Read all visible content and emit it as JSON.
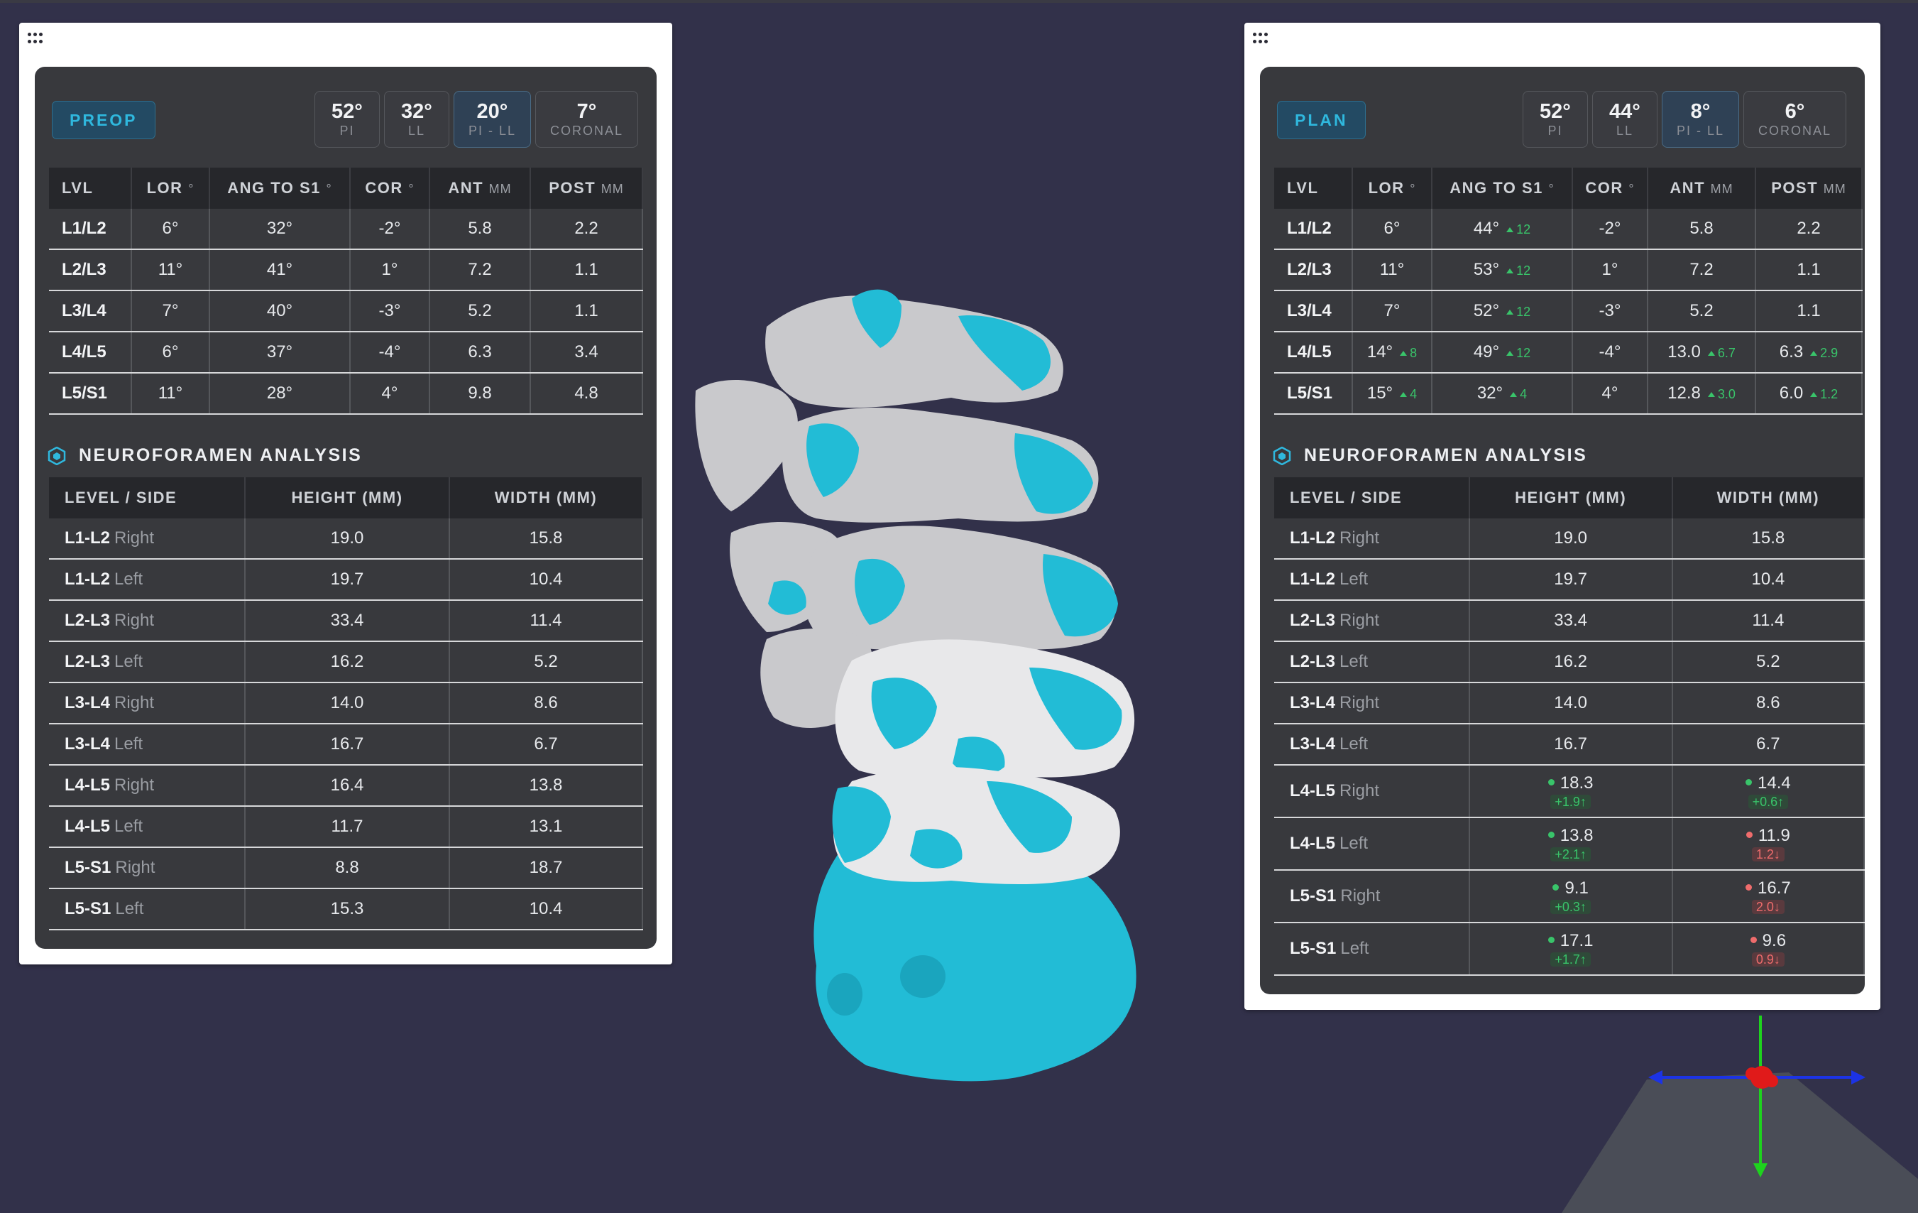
{
  "colors": {
    "background": "#32314a",
    "accent": "#2fb8de",
    "positive": "#39c46a",
    "negative": "#ef6c6c",
    "bone_gray": "#c9c9cc",
    "bone_cyan": "#22bcd6"
  },
  "icons": {
    "drag": "drag-handle-icon",
    "section": "hexagon-icon"
  },
  "panels": [
    {
      "mode": "PREOP",
      "stats": [
        {
          "value": "52°",
          "label": "PI"
        },
        {
          "value": "32°",
          "label": "LL"
        },
        {
          "value": "20°",
          "label": "PI - LL"
        },
        {
          "value": "7°",
          "label": "CORONAL"
        }
      ],
      "headers": {
        "lvl": "LVL",
        "lor": "LOR",
        "lor_unit": "°",
        "ang": "ANG TO S1",
        "ang_unit": "°",
        "cor": "COR",
        "cor_unit": "°",
        "ant": "ANT",
        "ant_unit": "MM",
        "post": "POST",
        "post_unit": "MM"
      },
      "levels": [
        {
          "lvl": "L1/L2",
          "lor": "6°",
          "ang": "32°",
          "cor": "-2°",
          "ant": "5.8",
          "post": "2.2"
        },
        {
          "lvl": "L2/L3",
          "lor": "11°",
          "ang": "41°",
          "cor": "1°",
          "ant": "7.2",
          "post": "1.1"
        },
        {
          "lvl": "L3/L4",
          "lor": "7°",
          "ang": "40°",
          "cor": "-3°",
          "ant": "5.2",
          "post": "1.1"
        },
        {
          "lvl": "L4/L5",
          "lor": "6°",
          "ang": "37°",
          "cor": "-4°",
          "ant": "6.3",
          "post": "3.4"
        },
        {
          "lvl": "L5/S1",
          "lor": "11°",
          "ang": "28°",
          "cor": "4°",
          "ant": "9.8",
          "post": "4.8"
        }
      ],
      "nf_title": "NEUROFORAMEN ANALYSIS",
      "nf_headers": {
        "level": "LEVEL / SIDE",
        "height": "HEIGHT (MM)",
        "width": "WIDTH (MM)"
      },
      "nf_rows": [
        {
          "level": "L1-L2",
          "side": "Right",
          "height": "19.0",
          "width": "15.8"
        },
        {
          "level": "L1-L2",
          "side": "Left",
          "height": "19.7",
          "width": "10.4"
        },
        {
          "level": "L2-L3",
          "side": "Right",
          "height": "33.4",
          "width": "11.4"
        },
        {
          "level": "L2-L3",
          "side": "Left",
          "height": "16.2",
          "width": "5.2"
        },
        {
          "level": "L3-L4",
          "side": "Right",
          "height": "14.0",
          "width": "8.6"
        },
        {
          "level": "L3-L4",
          "side": "Left",
          "height": "16.7",
          "width": "6.7"
        },
        {
          "level": "L4-L5",
          "side": "Right",
          "height": "16.4",
          "width": "13.8"
        },
        {
          "level": "L4-L5",
          "side": "Left",
          "height": "11.7",
          "width": "13.1"
        },
        {
          "level": "L5-S1",
          "side": "Right",
          "height": "8.8",
          "width": "18.7"
        },
        {
          "level": "L5-S1",
          "side": "Left",
          "height": "15.3",
          "width": "10.4"
        }
      ]
    },
    {
      "mode": "PLAN",
      "stats": [
        {
          "value": "52°",
          "label": "PI"
        },
        {
          "value": "44°",
          "label": "LL"
        },
        {
          "value": "8°",
          "label": "PI - LL"
        },
        {
          "value": "6°",
          "label": "CORONAL"
        }
      ],
      "headers": {
        "lvl": "LVL",
        "lor": "LOR",
        "lor_unit": "°",
        "ang": "ANG TO S1",
        "ang_unit": "°",
        "cor": "COR",
        "cor_unit": "°",
        "ant": "ANT",
        "ant_unit": "MM",
        "post": "POST",
        "post_unit": "MM"
      },
      "levels": [
        {
          "lvl": "L1/L2",
          "lor": "6°",
          "ang": "44°",
          "ang_d": "12",
          "cor": "-2°",
          "ant": "5.8",
          "post": "2.2"
        },
        {
          "lvl": "L2/L3",
          "lor": "11°",
          "ang": "53°",
          "ang_d": "12",
          "cor": "1°",
          "ant": "7.2",
          "post": "1.1"
        },
        {
          "lvl": "L3/L4",
          "lor": "7°",
          "ang": "52°",
          "ang_d": "12",
          "cor": "-3°",
          "ant": "5.2",
          "post": "1.1"
        },
        {
          "lvl": "L4/L5",
          "lor": "14°",
          "lor_d": "8",
          "ang": "49°",
          "ang_d": "12",
          "cor": "-4°",
          "ant": "13.0",
          "ant_d": "6.7",
          "post": "6.3",
          "post_d": "2.9"
        },
        {
          "lvl": "L5/S1",
          "lor": "15°",
          "lor_d": "4",
          "ang": "32°",
          "ang_d": "4",
          "cor": "4°",
          "ant": "12.8",
          "ant_d": "3.0",
          "post": "6.0",
          "post_d": "1.2"
        }
      ],
      "nf_title": "NEUROFORAMEN ANALYSIS",
      "nf_headers": {
        "level": "LEVEL / SIDE",
        "height": "HEIGHT (MM)",
        "width": "WIDTH (MM)"
      },
      "nf_rows": [
        {
          "level": "L1-L2",
          "side": "Right",
          "height": "19.0",
          "width": "15.8"
        },
        {
          "level": "L1-L2",
          "side": "Left",
          "height": "19.7",
          "width": "10.4"
        },
        {
          "level": "L2-L3",
          "side": "Right",
          "height": "33.4",
          "width": "11.4"
        },
        {
          "level": "L2-L3",
          "side": "Left",
          "height": "16.2",
          "width": "5.2"
        },
        {
          "level": "L3-L4",
          "side": "Right",
          "height": "14.0",
          "width": "8.6"
        },
        {
          "level": "L3-L4",
          "side": "Left",
          "height": "16.7",
          "width": "6.7"
        },
        {
          "level": "L4-L5",
          "side": "Right",
          "height": "18.3",
          "height_chg": "+1.9↑",
          "height_dir": "up",
          "width": "14.4",
          "width_chg": "+0.6↑",
          "width_dir": "up"
        },
        {
          "level": "L4-L5",
          "side": "Left",
          "height": "13.8",
          "height_chg": "+2.1↑",
          "height_dir": "up",
          "width": "11.9",
          "width_chg": "1.2↓",
          "width_dir": "down"
        },
        {
          "level": "L5-S1",
          "side": "Right",
          "height": "9.1",
          "height_chg": "+0.3↑",
          "height_dir": "up",
          "width": "16.7",
          "width_chg": "2.0↓",
          "width_dir": "down"
        },
        {
          "level": "L5-S1",
          "side": "Left",
          "height": "17.1",
          "height_chg": "+1.7↑",
          "height_dir": "up",
          "width": "9.6",
          "width_chg": "0.9↓",
          "width_dir": "down"
        }
      ]
    }
  ]
}
